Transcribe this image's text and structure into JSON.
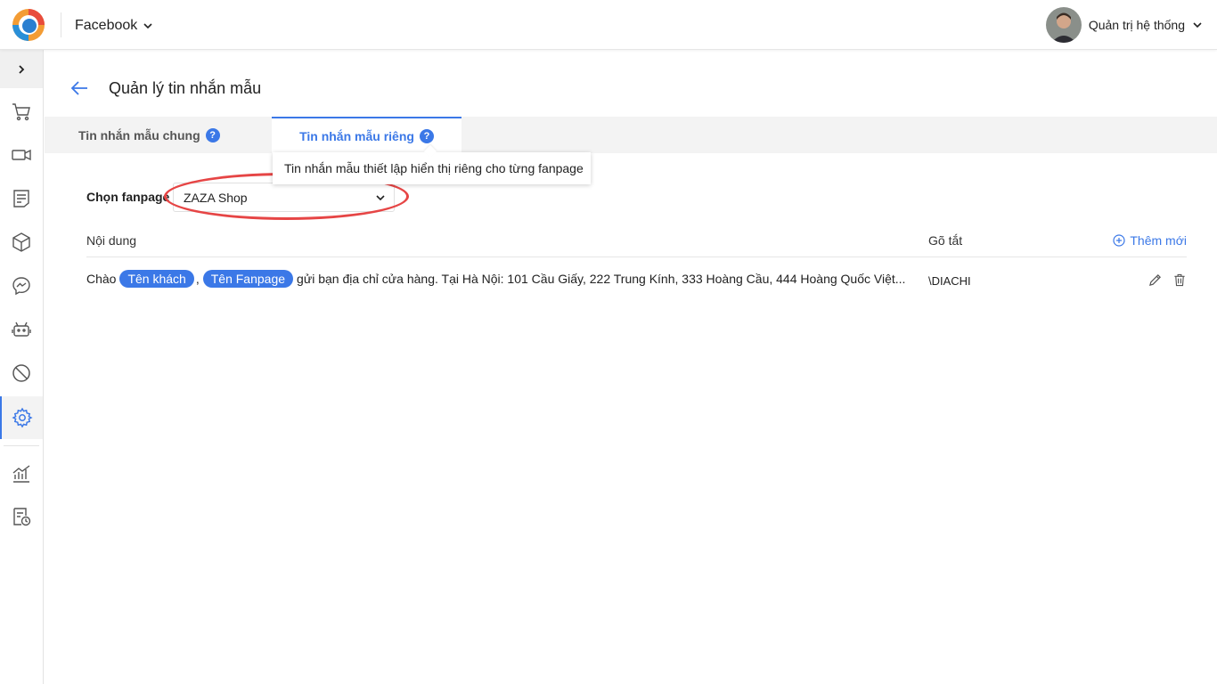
{
  "topbar": {
    "app_name": "Facebook",
    "user_name": "Quản trị hệ thống"
  },
  "sidebar": {
    "items": [
      {
        "icon": "cart-icon"
      },
      {
        "icon": "video-icon"
      },
      {
        "icon": "document-icon"
      },
      {
        "icon": "box-icon"
      },
      {
        "icon": "messenger-icon"
      },
      {
        "icon": "robot-icon"
      },
      {
        "icon": "block-icon"
      },
      {
        "icon": "gear-icon",
        "active": true
      },
      {
        "icon": "chart-icon"
      },
      {
        "icon": "schedule-icon"
      }
    ]
  },
  "page": {
    "title": "Quản lý tin nhắn mẫu"
  },
  "tabs": [
    {
      "label": "Tin nhắn mẫu chung",
      "help": "?"
    },
    {
      "label": "Tin nhắn mẫu riêng",
      "help": "?",
      "active": true
    }
  ],
  "tooltip": "Tin nhắn mẫu thiết lập hiển thị riêng cho từng fanpage",
  "fanpage": {
    "label": "Chọn fanpage",
    "selected": "ZAZA Shop"
  },
  "table": {
    "col_content": "Nội dung",
    "col_shortcut": "Gõ tắt",
    "add_new": "Thêm mới",
    "rows": [
      {
        "prefix": "Chào",
        "tag1": "Tên khách",
        "sep": ",",
        "tag2": "Tên Fanpage",
        "text": "gửi bạn địa chỉ cửa hàng. Tại Hà Nội: 101 Cầu Giấy, 222 Trung Kính, 333 Hoàng Cầu, 444 Hoàng Quốc Việt...",
        "shortcut": "\\DIACHI"
      }
    ]
  },
  "colors": {
    "accent": "#3b78e7",
    "highlight": "#e64545"
  }
}
